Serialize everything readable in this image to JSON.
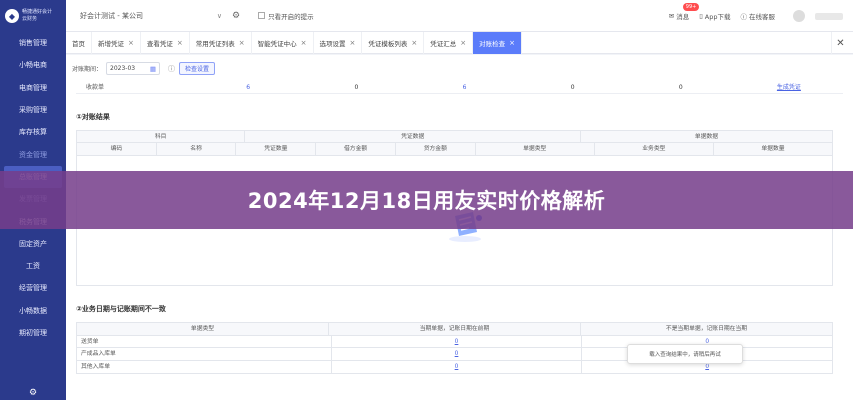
{
  "sidebar": {
    "logo_text_1": "畅捷通好会计",
    "logo_text_2": "云财务",
    "items": [
      {
        "label": "销售管理",
        "state": "normal"
      },
      {
        "label": "小畅电商",
        "state": "normal"
      },
      {
        "label": "电商管理",
        "state": "normal"
      },
      {
        "label": "采购管理",
        "state": "normal"
      },
      {
        "label": "库存核算",
        "state": "normal"
      },
      {
        "label": "资金管理",
        "state": "dim"
      },
      {
        "label": "总账管理",
        "state": "active"
      },
      {
        "label": "发票管理",
        "state": "dim"
      },
      {
        "label": "税务管理",
        "state": "normal"
      },
      {
        "label": "固定资产",
        "state": "normal"
      },
      {
        "label": "工资",
        "state": "normal"
      },
      {
        "label": "经营管理",
        "state": "normal"
      },
      {
        "label": "小畅数据",
        "state": "normal"
      },
      {
        "label": "期初管理",
        "state": "normal"
      }
    ]
  },
  "topbar": {
    "company": "好会计测试 - 某公司",
    "reminder_label": "只看开启的提示",
    "right": {
      "message_label": "消息",
      "message_badge": "99+",
      "app_label": "App下载",
      "help_label": "在线客服"
    }
  },
  "tabs": [
    {
      "label": "首页",
      "closable": false,
      "active": false
    },
    {
      "label": "新增凭证",
      "closable": true,
      "active": false
    },
    {
      "label": "查看凭证",
      "closable": true,
      "active": false
    },
    {
      "label": "常用凭证列表",
      "closable": true,
      "active": false
    },
    {
      "label": "智能凭证中心",
      "closable": true,
      "active": false
    },
    {
      "label": "选项设置",
      "closable": true,
      "active": false
    },
    {
      "label": "凭证模板列表",
      "closable": true,
      "active": false
    },
    {
      "label": "凭证汇总",
      "closable": true,
      "active": false
    },
    {
      "label": "对账检查",
      "closable": true,
      "active": true
    }
  ],
  "filter": {
    "period_label": "对账期间：",
    "period_value": "2023-03",
    "button_label": "检查设置"
  },
  "strip": {
    "label": "收款单",
    "values": [
      "6",
      "0",
      "6",
      "0",
      "0"
    ],
    "action": "生成凭证"
  },
  "section1": {
    "title": "①对账结果",
    "group_headers": [
      "科目",
      "凭证数据",
      "单据数据"
    ],
    "columns": [
      "编码",
      "名称",
      "凭证数量",
      "借方金额",
      "贷方金额",
      "单据类型",
      "业务类型",
      "单据数量"
    ]
  },
  "section2": {
    "title": "②业务日期与记账期间不一致",
    "columns": [
      "单据类型",
      "当期单据，记账日期在前期",
      "不是当期单据，记账日期在当期"
    ],
    "rows": [
      {
        "type": "送货单",
        "a": "0",
        "b": "0"
      },
      {
        "type": "产成品入库单",
        "a": "0",
        "b": "0"
      },
      {
        "type": "其他入库单",
        "a": "0",
        "b": "0"
      }
    ]
  },
  "tooltip": "载入查询结果中，请稍后再试",
  "banner": {
    "title": "2024年12月18日用友实时价格解析"
  },
  "colors": {
    "sidebar": "#2b3a8c",
    "accent": "#5b7cfa",
    "banner": "#763e8a"
  }
}
